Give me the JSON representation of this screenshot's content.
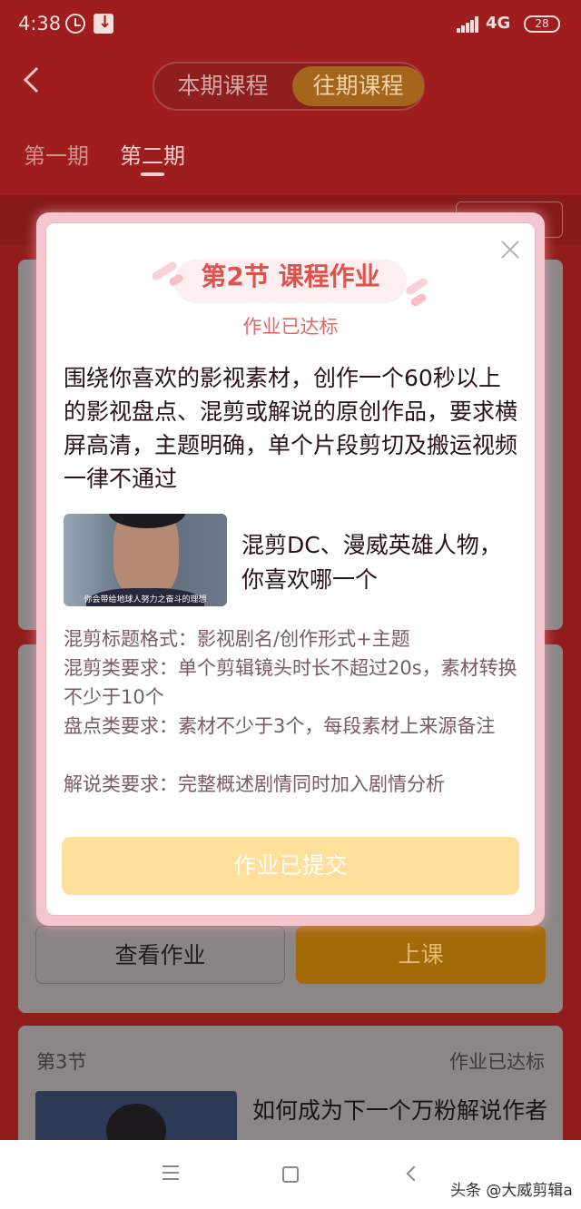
{
  "status_bar": {
    "time": "4:38",
    "network": "4G",
    "battery": "28"
  },
  "header": {
    "tabs": [
      "本期课程",
      "往期课程"
    ],
    "periods": [
      "第一期",
      "第二期"
    ]
  },
  "lesson3": {
    "label": "第3节",
    "status": "作业已达标",
    "title": "如何成为下一个万粉解说作者"
  },
  "lesson2_buttons": {
    "view_homework": "查看作业",
    "attend_class": "上课"
  },
  "modal": {
    "title": "第2节  课程作业",
    "status": "作业已达标",
    "description": "围绕你喜欢的影视素材，创作一个60秒以上的影视盘点、混剪或解说的原创作品，要求横屏高清，主题明确，单个片段剪切及搬运视频一律不通过",
    "media_subtitle": "你会带给地球人努力之奋斗的理想",
    "media_text": "混剪DC、漫威英雄人物，你喜欢哪一个",
    "requirements": [
      "混剪标题格式：影视剧名/创作形式+主题",
      "混剪类要求：单个剪辑镜头时长不超过20s，素材转换不少于10个",
      "盘点类要求：素材不少于3个，每段素材上来源备注",
      "解说类要求：完整概述剧情同时加入剧情分析"
    ],
    "submit_button": "作业已提交"
  },
  "watermark": "头条 @大威剪辑a"
}
